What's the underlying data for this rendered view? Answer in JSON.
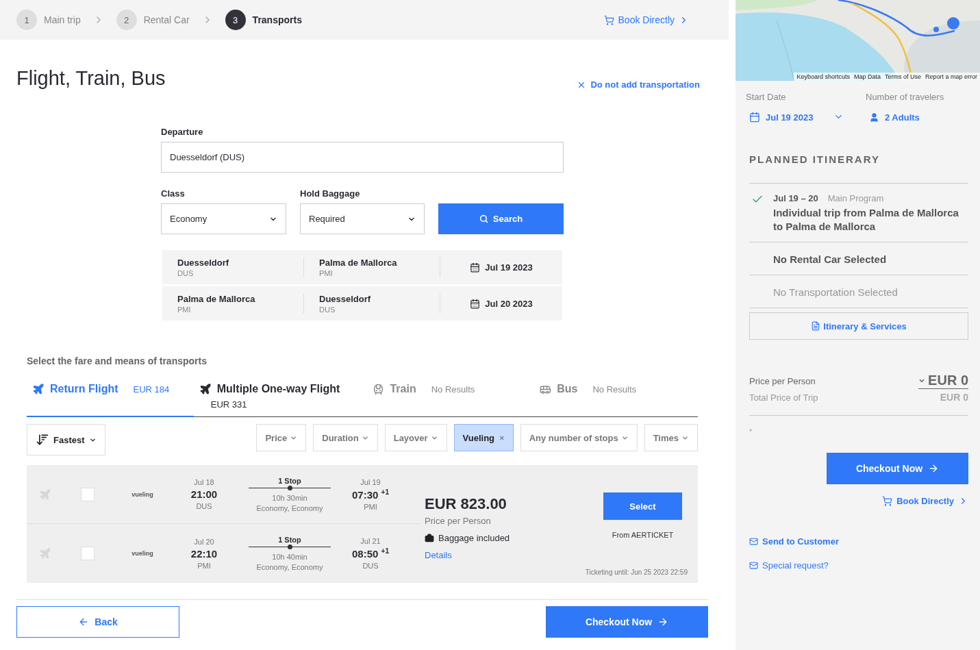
{
  "steps": [
    {
      "number": "1",
      "label": "Main trip",
      "selected": false
    },
    {
      "number": "2",
      "label": "Rental Car",
      "selected": false
    },
    {
      "number": "3",
      "label": "Transports",
      "selected": true
    }
  ],
  "book_directly": "Book Directly",
  "title": "Flight, Train, Bus",
  "no_transport": "Do not add transportation",
  "form": {
    "departure": {
      "label": "Departure",
      "value": "Duesseldorf (DUS)"
    },
    "class": {
      "label": "Class",
      "value": "Economy"
    },
    "baggage": {
      "label": "Hold Baggage",
      "value": "Required"
    },
    "search_button": "Search"
  },
  "legs": [
    {
      "from": "Duesseldorf",
      "from_code": "DUS",
      "to": "Palma de Mallorca",
      "to_code": "PMI",
      "date": "Jul 19 2023"
    },
    {
      "from": "Palma de Mallorca",
      "from_code": "PMI",
      "to": "Duesseldorf",
      "to_code": "DUS",
      "date": "Jul 20 2023"
    }
  ],
  "section_label": "Select the fare and means of transports",
  "tabs": [
    {
      "kind": "flight",
      "label": "Return Flight",
      "price": "EUR 184",
      "selected": true,
      "inline": true
    },
    {
      "kind": "flight",
      "label": "Multiple One-way Flight",
      "price": "EUR 331",
      "selected": false,
      "inline": false
    },
    {
      "kind": "train",
      "label": "Train",
      "price": "No Results",
      "selected": false,
      "inline": true
    },
    {
      "kind": "bus",
      "label": "Bus",
      "price": "No Results",
      "selected": false,
      "inline": true
    }
  ],
  "sort": "Fastest",
  "filters": [
    {
      "label": "Price",
      "selected": false
    },
    {
      "label": "Duration",
      "selected": false
    },
    {
      "label": "Layover",
      "selected": false
    },
    {
      "label": "Vueling",
      "selected": true,
      "remove": "×"
    },
    {
      "label": "Any number of stops",
      "selected": false
    },
    {
      "label": "Times",
      "selected": false
    }
  ],
  "result": {
    "segments": [
      {
        "checked": false,
        "airline": "vueling",
        "dep_date": "Jul 18",
        "dep_time": "21:00",
        "dep_code": "DUS",
        "stops": "1 Stop",
        "duration": "10h 30min",
        "cabin": "Economy, Economy",
        "arr_date": "Jul 19",
        "arr_time": "07:30",
        "day_offset": "+1",
        "arr_code": "PMI"
      },
      {
        "checked": false,
        "airline": "vueling",
        "dep_date": "Jul 20",
        "dep_time": "22:10",
        "dep_code": "PMI",
        "stops": "1 Stop",
        "duration": "10h 40min",
        "cabin": "Economy, Economy",
        "arr_date": "Jul 21",
        "arr_time": "08:50",
        "day_offset": "+1",
        "arr_code": "DUS"
      }
    ],
    "price": "EUR 823.00",
    "price_note": "Price per Person",
    "baggage": "Baggage included",
    "details": "Details",
    "select": "Select",
    "source": "From AERTICKET",
    "ticketing": "Ticketing until: Jun 25 2023 22:59"
  },
  "back": "Back",
  "checkout": "Checkout Now",
  "sidebar": {
    "map": {
      "links": [
        "Keyboard shortcuts",
        "Map Data",
        "Terms of Use",
        "Report a map error"
      ]
    },
    "start_date_label": "Start Date",
    "start_date": "Jul 19 2023",
    "travelers_label": "Number of travelers",
    "travelers": "2 Adults",
    "itinerary_title": "PLANNED ITINERARY",
    "itinerary": [
      {
        "kind": "program",
        "done": true,
        "dates": "Jul 19 – 20",
        "type": "Main Program",
        "title": "Individual trip from Palma de Mallorca to Palma de Mallorca"
      },
      {
        "kind": "empty",
        "dim": false,
        "title": "No Rental Car Selected"
      },
      {
        "kind": "empty",
        "dim": true,
        "title": "No Transportation Selected"
      }
    ],
    "itinerary_button": "Itinerary & Services",
    "price_label": "Price per Person",
    "price": "EUR 0",
    "total_label": "Total Price of Trip",
    "total": "EUR 0",
    "note": "*",
    "checkout": "Checkout Now",
    "book_directly": "Book Directly",
    "actions": [
      "Send to Customer",
      "Special request?"
    ]
  }
}
